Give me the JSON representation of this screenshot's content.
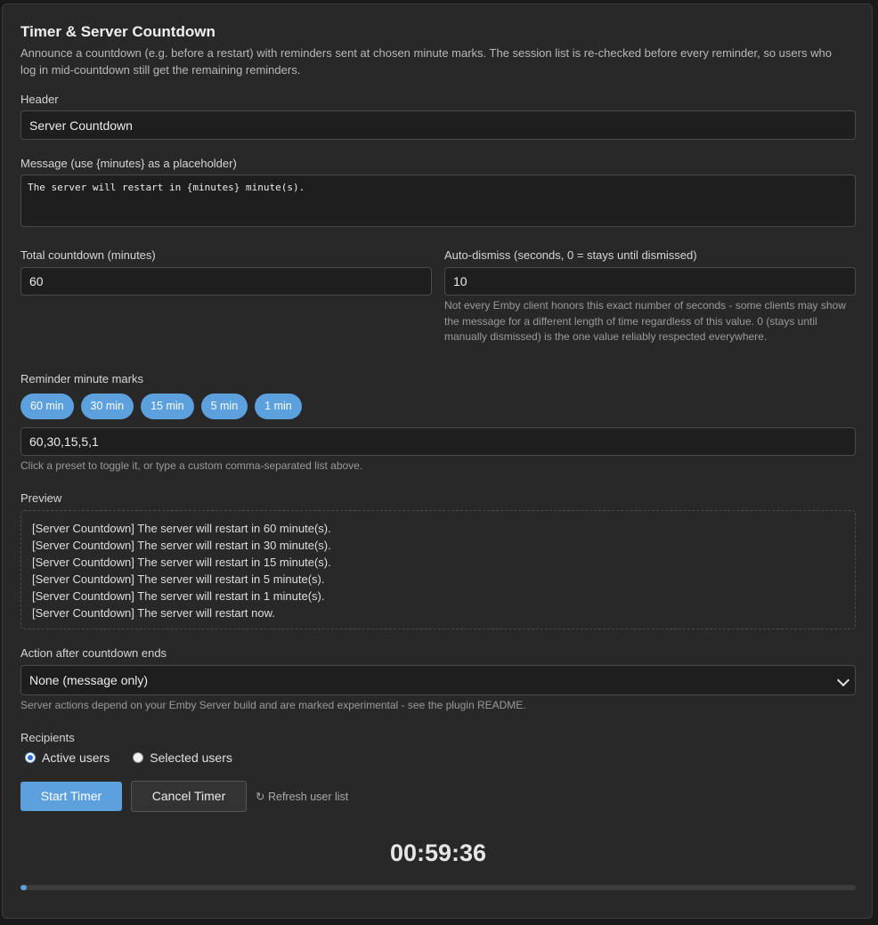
{
  "panel": {
    "title": "Timer & Server Countdown",
    "description": "Announce a countdown (e.g. before a restart) with reminders sent at chosen minute marks. The session list is re-checked before every reminder, so users who log in mid-countdown still get the remaining reminders."
  },
  "header_field": {
    "label": "Header",
    "value": "Server Countdown"
  },
  "message_field": {
    "label": "Message (use {minutes} as a placeholder)",
    "value": "The server will restart in {minutes} minute(s)."
  },
  "total_countdown": {
    "label": "Total countdown (minutes)",
    "value": "60"
  },
  "auto_dismiss": {
    "label": "Auto-dismiss (seconds, 0 = stays until dismissed)",
    "value": "10",
    "hint": "Not every Emby client honors this exact number of seconds - some clients may show the message for a different length of time regardless of this value. 0 (stays until manually dismissed) is the one value reliably respected everywhere."
  },
  "reminders": {
    "label": "Reminder minute marks",
    "presets": [
      "60 min",
      "30 min",
      "15 min",
      "5 min",
      "1 min"
    ],
    "value": "60,30,15,5,1",
    "hint": "Click a preset to toggle it, or type a custom comma-separated list above."
  },
  "preview": {
    "label": "Preview",
    "lines": [
      "[Server Countdown] The server will restart in 60 minute(s).",
      "[Server Countdown] The server will restart in 30 minute(s).",
      "[Server Countdown] The server will restart in 15 minute(s).",
      "[Server Countdown] The server will restart in 5 minute(s).",
      "[Server Countdown] The server will restart in 1 minute(s).",
      "[Server Countdown] The server will restart now."
    ]
  },
  "action": {
    "label": "Action after countdown ends",
    "selected": "None (message only)",
    "hint": "Server actions depend on your Emby Server build and are marked experimental - see the plugin README."
  },
  "recipients": {
    "label": "Recipients",
    "active": "Active users",
    "selected": "Selected users",
    "checked": "active"
  },
  "buttons": {
    "start": "Start Timer",
    "cancel": "Cancel Timer",
    "refresh": "Refresh user list",
    "refresh_icon": "↻"
  },
  "countdown": {
    "display": "00:59:36",
    "progress_percent": 0.7
  },
  "colors": {
    "accent": "#5da0de",
    "panel": "#282828",
    "input_bg": "#1e1e1e"
  }
}
